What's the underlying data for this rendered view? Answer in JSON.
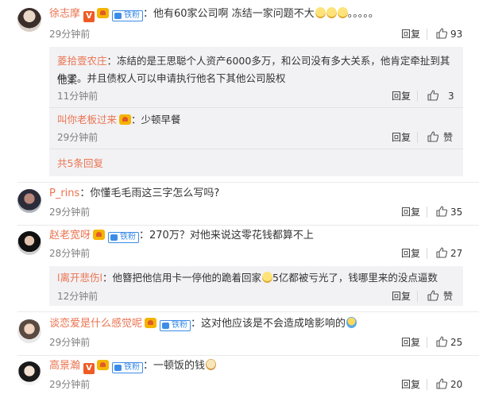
{
  "ui": {
    "reply_label": "回复"
  },
  "comments": [
    {
      "name": "徐志摩",
      "text": "：他有60家公司啊 冻结一家问题不大",
      "tail": "。。。。。",
      "time": "29分钟前",
      "likes": "93",
      "badges": [
        "verified",
        "vip",
        "fan"
      ],
      "emoji": "face-emoji",
      "fan_label": "铁粉",
      "v_label": "V"
    },
    {
      "name": "P_rins",
      "text": "：你懂毛毛雨这三字怎么写吗?",
      "time": "29分钟前",
      "likes": "35"
    },
    {
      "name": "赵老宽呀",
      "text": "：270万？对他来说这零花钱都算不上",
      "time": "28分钟前",
      "likes": "27",
      "fan_label": "铁粉"
    },
    {
      "name": "谈恋爱是什么感觉呢",
      "text": "：这对他应该是不会造成啥影响的",
      "time": "29分钟前",
      "likes": "25",
      "fan_label": "铁粉"
    },
    {
      "name": "高景瀚",
      "text": "：一顿饭的钱",
      "time": "29分钟前",
      "likes": "20",
      "v_label": "V",
      "fan_label": "铁粉"
    }
  ],
  "replies_1": [
    {
      "name": "菱拾壹农庄",
      "text_line1": "：冻结的是王思聪个人资产6000多万，和公司没有多大关系，他肯定牵扯到其他案",
      "text_line2": "件了。并且债权人可以申请执行他名下其他公司股权",
      "time": "11分钟前",
      "likes": "3"
    },
    {
      "name": "叫你老板过来",
      "text": "：少顿早餐",
      "time": "29分钟前",
      "likes": "赞"
    }
  ],
  "more_replies": "共5条回复",
  "replies_3": [
    {
      "name": "l离开悲伤l",
      "text1": "：他簪把他信用卡一停他的跪着回家",
      "text2": "5亿都被亏光了，钱哪里来的没点逼数",
      "time": "12分钟前",
      "likes": "赞"
    }
  ]
}
